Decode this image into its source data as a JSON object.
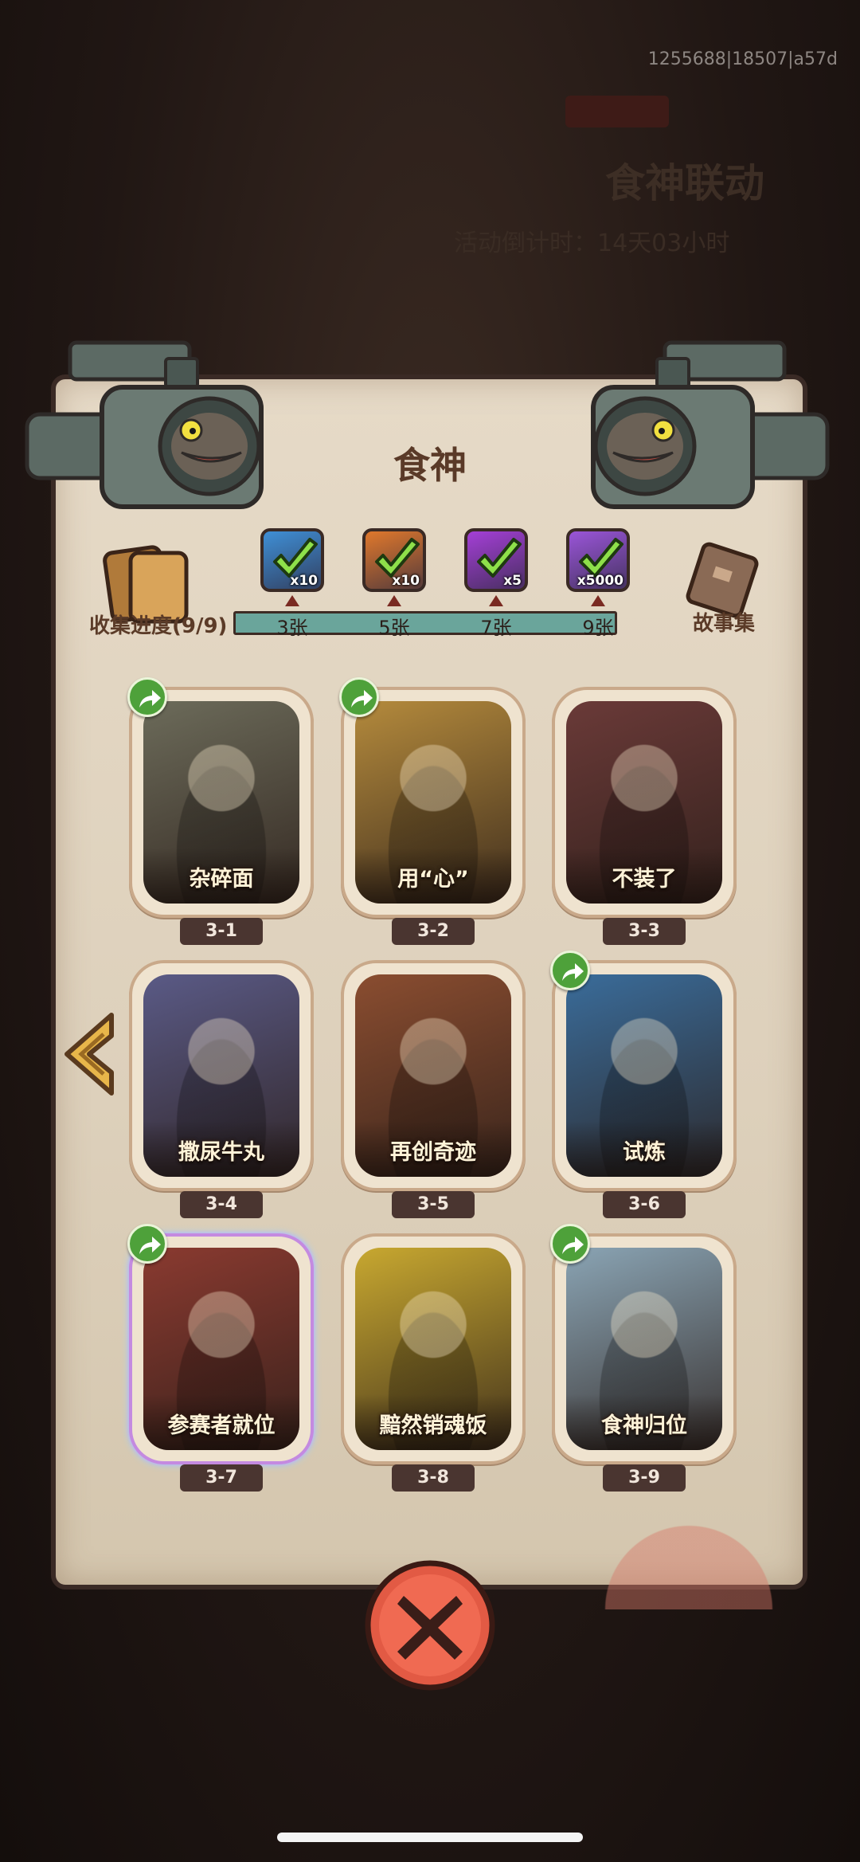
{
  "status_bar": {
    "debug_id": "1255688|18507|a57d"
  },
  "background": {
    "event_title": "食神联动",
    "event_countdown": "活动倒计时：14天03小时"
  },
  "panel": {
    "title": "食神",
    "collect_label": "收集进度(9/9)",
    "story_label": "故事集"
  },
  "rewards": [
    {
      "milestone": "3张",
      "qty": "x10",
      "color": "#3f8fd6",
      "claimed": true
    },
    {
      "milestone": "5张",
      "qty": "x10",
      "color": "#e0782c",
      "claimed": true
    },
    {
      "milestone": "7张",
      "qty": "x5",
      "color": "#a43fd6",
      "claimed": true
    },
    {
      "milestone": "9张",
      "qty": "x5000",
      "color": "#9a55d8",
      "claimed": true
    }
  ],
  "cards": [
    {
      "code": "3-1",
      "title": "杂碎面",
      "share": true,
      "tint": "#6c6b5a"
    },
    {
      "code": "3-2",
      "title": "用“心”",
      "share": true,
      "tint": "#b48a3c"
    },
    {
      "code": "3-3",
      "title": "不装了",
      "share": false,
      "tint": "#6a3a38"
    },
    {
      "code": "3-4",
      "title": "撒尿牛丸",
      "share": false,
      "tint": "#5a5a86"
    },
    {
      "code": "3-5",
      "title": "再创奇迹",
      "share": false,
      "tint": "#8a4d30"
    },
    {
      "code": "3-6",
      "title": "试炼",
      "share": true,
      "tint": "#3a6c9a"
    },
    {
      "code": "3-7",
      "title": "参赛者就位",
      "share": true,
      "tint": "#8a3a30",
      "special": true
    },
    {
      "code": "3-8",
      "title": "黯然销魂饭",
      "share": false,
      "tint": "#c8a830"
    },
    {
      "code": "3-9",
      "title": "食神归位",
      "share": true,
      "tint": "#8aa4b4"
    }
  ],
  "icons": {
    "close": "close-x-icon",
    "nav_left": "chevron-left-icon",
    "share": "share-arrow-icon",
    "check": "checkmark-icon"
  }
}
